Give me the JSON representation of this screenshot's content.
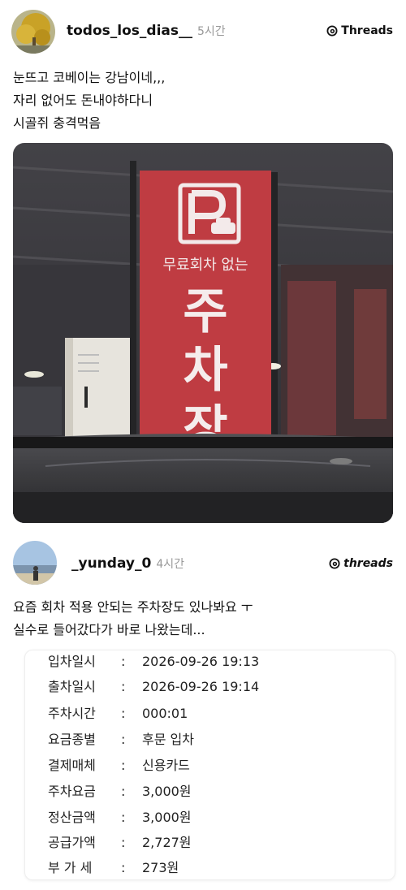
{
  "post1": {
    "username": "todos_los_dias__",
    "time": "5시간",
    "brand": "Threads",
    "lines": [
      "눈뜨고 코베이는 강남이네,,,",
      "자리 없어도 돈내야하다니",
      "시골쥐 충격먹음"
    ],
    "sign": {
      "icon": "parking-car-icon",
      "subtitle": "무료회차 없는",
      "chars": [
        "주",
        "차",
        "장"
      ]
    }
  },
  "post2": {
    "username": "_yunday_0",
    "time": "4시간",
    "brand": "threads",
    "lines": [
      "요즘 회차 적용 안되는 주차장도 있나봐요 ㅜ",
      "실수로 들어갔다가 바로 나왔는데..."
    ],
    "receipt": [
      {
        "label": "입차일시",
        "value": "2026-09-26  19:13"
      },
      {
        "label": "출차일시",
        "value": "2026-09-26  19:14"
      },
      {
        "label": "주차시간",
        "value": "000:01"
      },
      {
        "label": "요금종별",
        "value": "후문 입차"
      },
      {
        "label": "결제매체",
        "value": "신용카드"
      },
      {
        "label": "주차요금",
        "value": "3,000원"
      },
      {
        "label": "정산금액",
        "value": "3,000원"
      },
      {
        "label": "공급가액",
        "value": "2,727원"
      },
      {
        "label": "부 가 세",
        "value": "273원"
      }
    ],
    "colon": ":"
  },
  "colors": {
    "banner_red": "#c8383f",
    "time_gray": "#999999"
  }
}
